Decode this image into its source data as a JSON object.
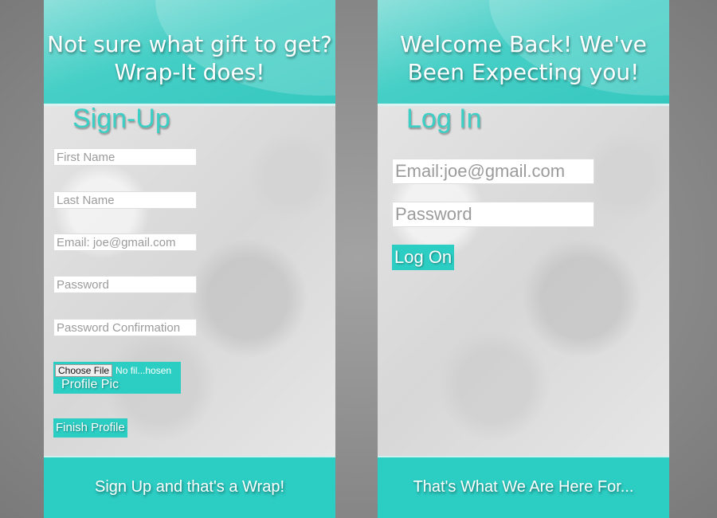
{
  "signup": {
    "header_line1": "Not sure what gift to get?",
    "header_line2": "Wrap-It does!",
    "title": "Sign-Up",
    "first_name_placeholder": "First Name",
    "last_name_placeholder": "Last Name",
    "email_placeholder": "Email: joe@gmail.com",
    "password_placeholder": "Password",
    "password_confirmation_placeholder": "Password Confirmation",
    "choose_file_label": "Choose File",
    "no_file_text": "No fil...hosen",
    "profile_pic_label": "Profile Pic",
    "finish_button": "Finish Profile",
    "footer_text": "Sign Up and that's a Wrap!"
  },
  "login": {
    "header_line1": "Welcome Back! We've",
    "header_line2": "Been Expecting you!",
    "title": "Log In",
    "email_placeholder": "Email:joe@gmail.com",
    "password_placeholder": "Password",
    "logon_button": "Log On",
    "footer_text": "That's What We Are Here For..."
  },
  "colors": {
    "accent": "#2ccdc3",
    "header_light": "#8fe0db",
    "backdrop": "#8a8a8a"
  }
}
